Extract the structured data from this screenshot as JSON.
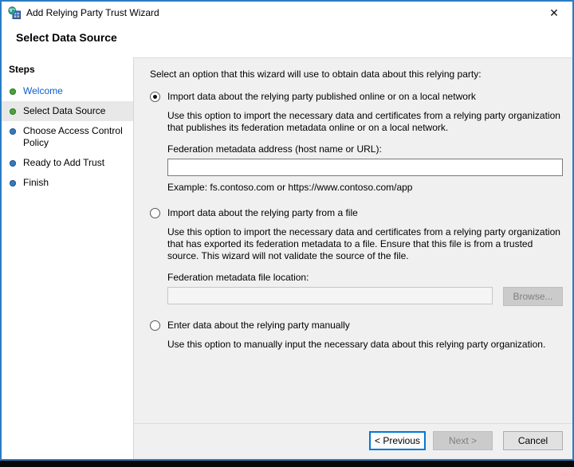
{
  "window": {
    "title": "Add Relying Party Trust Wizard",
    "close_glyph": "✕"
  },
  "header": {
    "title": "Select Data Source"
  },
  "sidebar": {
    "title": "Steps",
    "items": [
      {
        "label": "Welcome",
        "state": "visited-link",
        "bullet": "green"
      },
      {
        "label": "Select Data Source",
        "state": "current",
        "bullet": "green"
      },
      {
        "label": "Choose Access Control Policy",
        "state": "upcoming",
        "bullet": "blue"
      },
      {
        "label": "Ready to Add Trust",
        "state": "upcoming",
        "bullet": "blue"
      },
      {
        "label": "Finish",
        "state": "upcoming",
        "bullet": "blue"
      }
    ]
  },
  "main": {
    "intro": "Select an option that this wizard will use to obtain data about this relying party:",
    "options": [
      {
        "label": "Import data about the relying party published online or on a local network",
        "selected": true,
        "description": "Use this option to import the necessary data and certificates from a relying party organization that publishes its federation metadata online or on a local network.",
        "field_label": "Federation metadata address (host name or URL):",
        "field_value": "",
        "example": "Example: fs.contoso.com or https://www.contoso.com/app"
      },
      {
        "label": "Import data about the relying party from a file",
        "selected": false,
        "description": "Use this option to import the necessary data and certificates from a relying party organization that has exported its federation metadata to a file. Ensure that this file is from a trusted source.  This wizard will not validate the source of the file.",
        "field_label": "Federation metadata file location:",
        "field_value": "",
        "browse_label": "Browse..."
      },
      {
        "label": "Enter data about the relying party manually",
        "selected": false,
        "description": "Use this option to manually input the necessary data about this relying party organization."
      }
    ]
  },
  "footer": {
    "previous_label": "< Previous",
    "next_label": "Next >",
    "cancel_label": "Cancel"
  },
  "colors": {
    "window_border": "#2b7cc4",
    "focus_accent": "#0078d7",
    "link_blue": "#0b5fd0",
    "bullet_green": "#4ca33f",
    "bullet_blue": "#3a7ab9",
    "pane_gray": "#f0f0f0",
    "disabled_text": "#7f7f7f"
  }
}
